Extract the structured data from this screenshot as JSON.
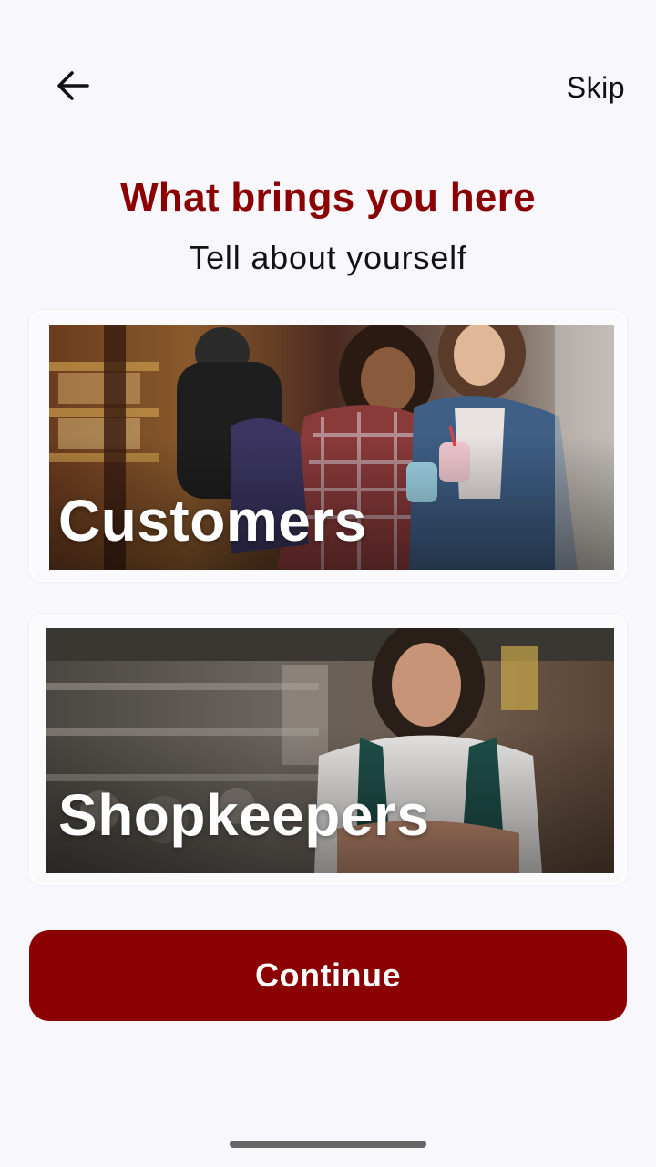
{
  "colors": {
    "accent": "#8b0000",
    "background": "#f7f7fc",
    "text": "#111111"
  },
  "header": {
    "back_icon": "arrow-left-icon",
    "skip_label": "Skip"
  },
  "main": {
    "title": "What brings you here",
    "subtitle": "Tell about yourself",
    "options": [
      {
        "label": "Customers",
        "image": "customers-photo"
      },
      {
        "label": "Shopkeepers",
        "image": "shopkeepers-photo"
      }
    ]
  },
  "footer": {
    "continue_label": "Continue"
  }
}
